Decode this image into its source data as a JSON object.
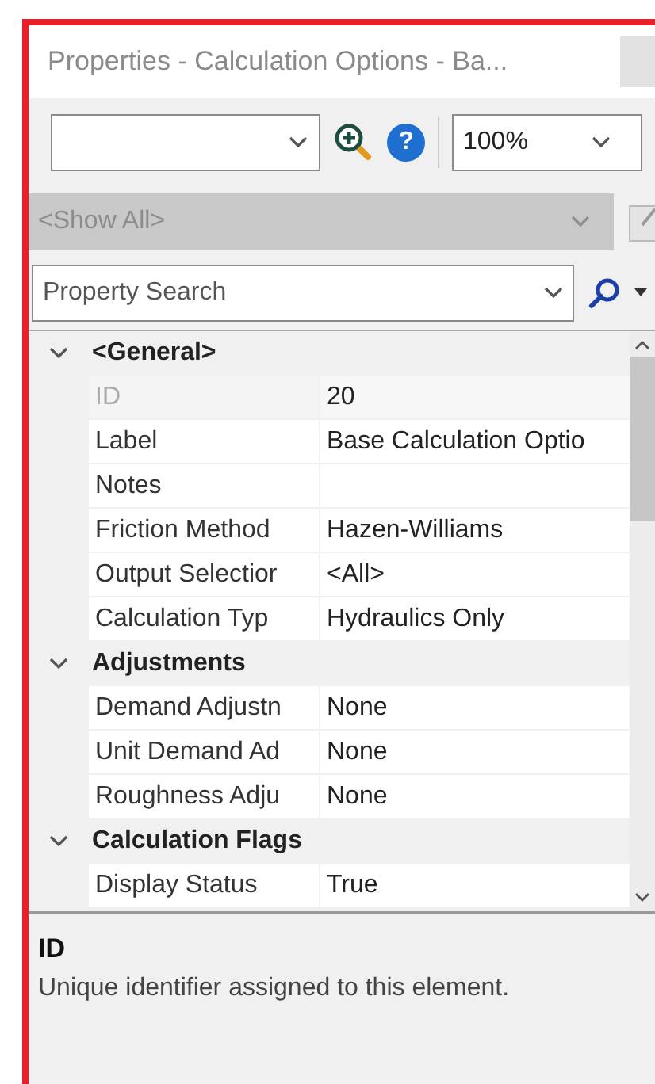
{
  "window": {
    "title": "Properties - Calculation Options - Ba..."
  },
  "toolbar": {
    "help": "?",
    "zoom": "100%"
  },
  "filter": {
    "value": "<Show All>",
    "disabled": true
  },
  "search": {
    "placeholder": "Property Search"
  },
  "grid": {
    "categories": [
      {
        "name": "<General>",
        "expanded": true,
        "properties": [
          {
            "name": "ID",
            "value": "20",
            "readonly": true
          },
          {
            "name": "Label",
            "value": "Base Calculation Optio",
            "readonly": false
          },
          {
            "name": "Notes",
            "readonly": false
          },
          {
            "name": "Friction Method",
            "value": "Hazen-Williams",
            "readonly": false
          },
          {
            "name": "Output Selectior",
            "value": "<All>",
            "readonly": false
          },
          {
            "name": "Calculation Typ",
            "value": "Hydraulics Only",
            "readonly": false
          }
        ]
      },
      {
        "name": "Adjustments",
        "expanded": true,
        "properties": [
          {
            "name": "Demand Adjustn",
            "value": "None",
            "readonly": false
          },
          {
            "name": "Unit Demand Ad",
            "value": "None",
            "readonly": false
          },
          {
            "name": "Roughness Adju",
            "value": "None",
            "readonly": false
          }
        ]
      },
      {
        "name": "Calculation Flags",
        "expanded": true,
        "properties": [
          {
            "name": "Display Status",
            "value": "True",
            "readonly": false
          }
        ]
      }
    ]
  },
  "description": {
    "title": "ID",
    "text": "Unique identifier assigned to this element."
  }
}
